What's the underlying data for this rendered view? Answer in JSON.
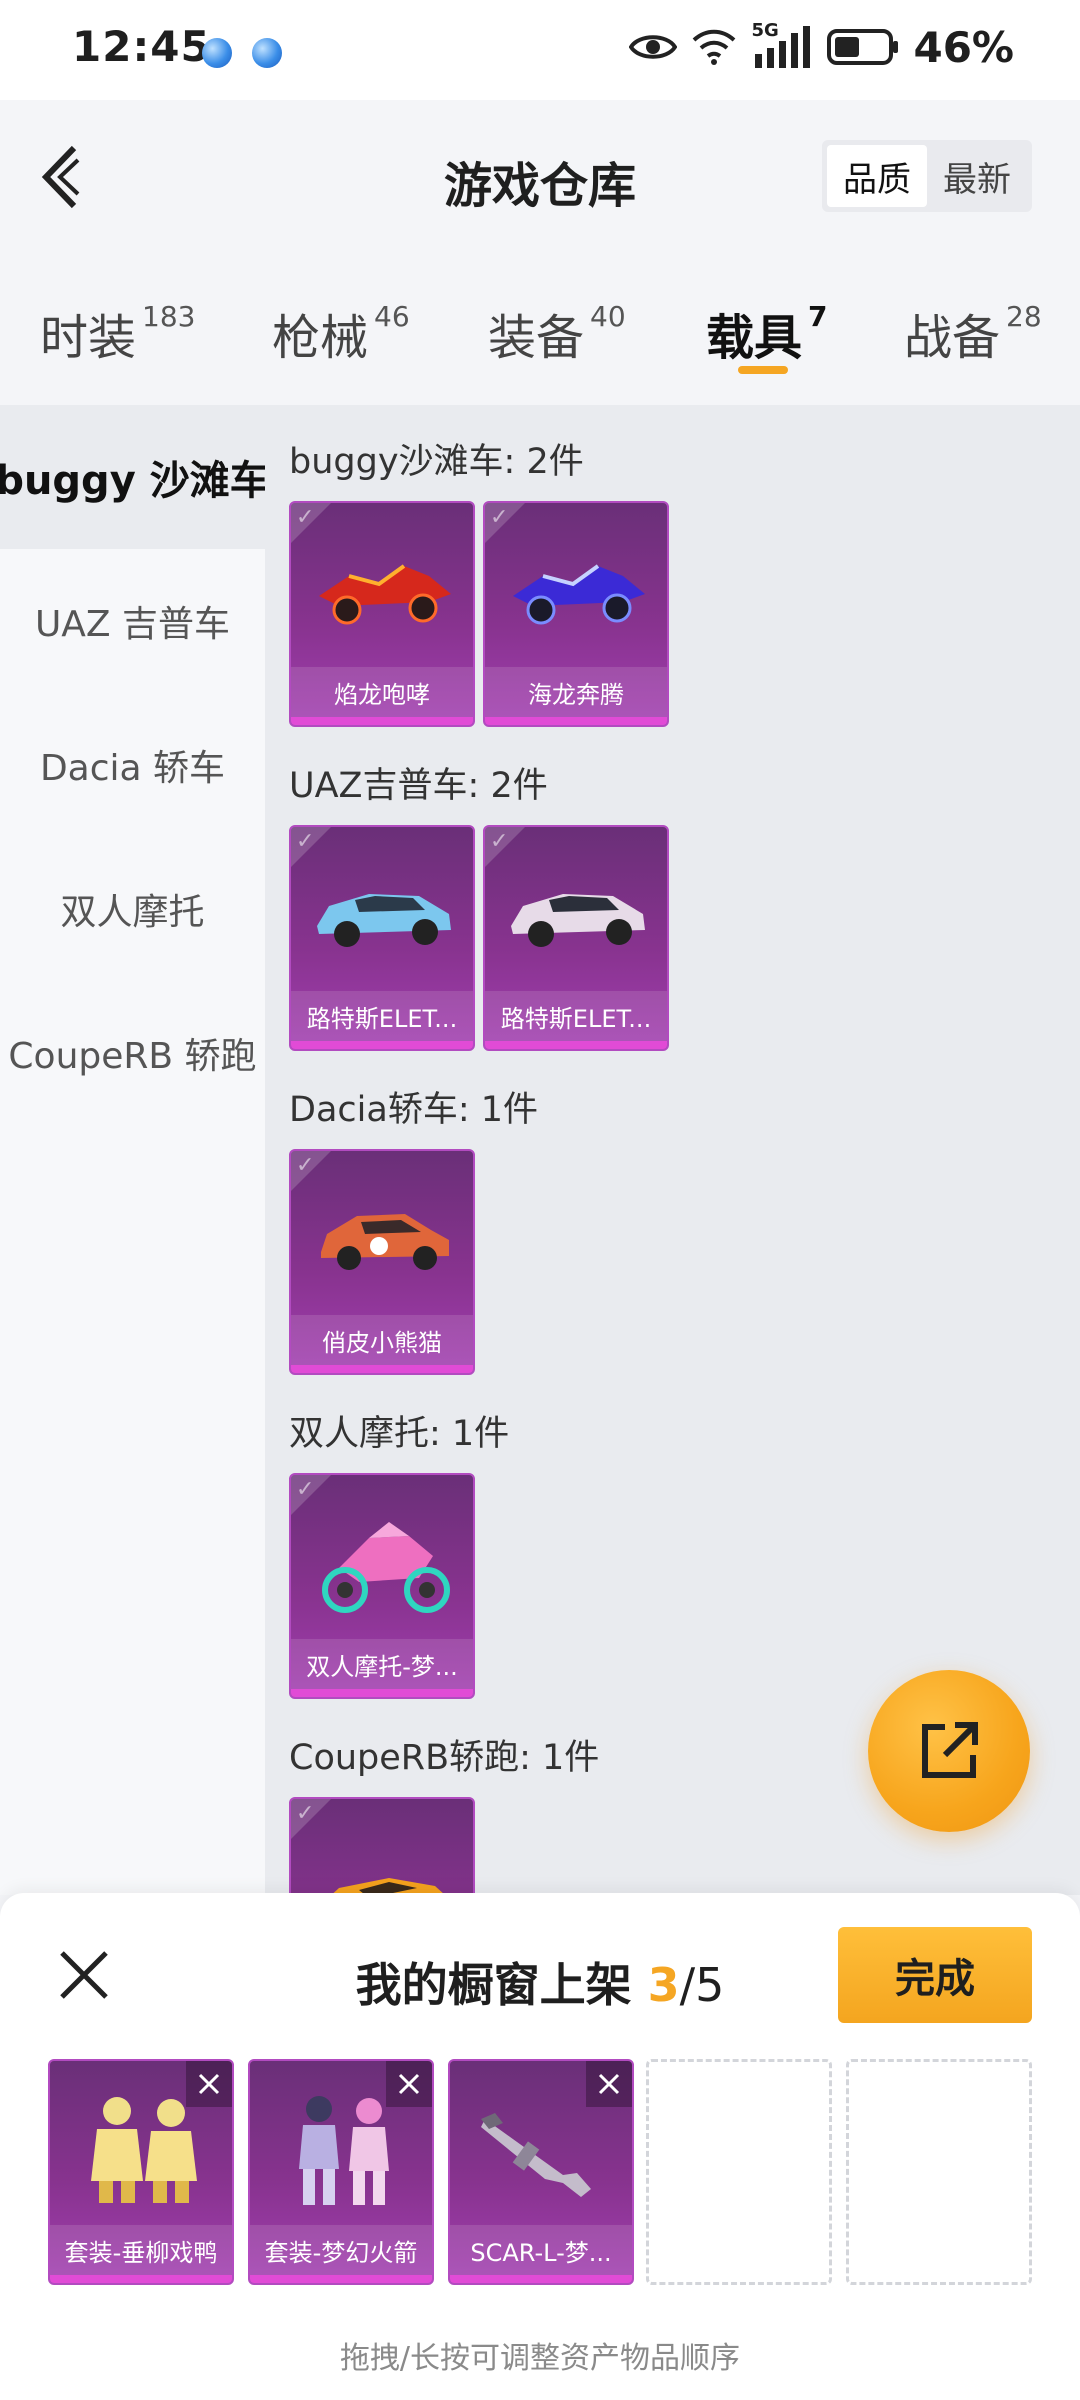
{
  "status_bar": {
    "time": "12:45",
    "network": "5G",
    "battery": "46%"
  },
  "header": {
    "title": "游戏仓库",
    "sort_options": [
      "品质",
      "最新"
    ],
    "sort_active": "品质"
  },
  "tabs": [
    {
      "label": "时装",
      "count": "183"
    },
    {
      "label": "枪械",
      "count": "46"
    },
    {
      "label": "装备",
      "count": "40"
    },
    {
      "label": "载具",
      "count": "7",
      "active": true
    },
    {
      "label": "战备",
      "count": "28"
    }
  ],
  "sidebar": {
    "items": [
      "buggy 沙滩车",
      "UAZ 吉普车",
      "Dacia 轿车",
      "双人摩托",
      "CoupeRB 轿跑"
    ],
    "active_index": 0
  },
  "groups": [
    {
      "title": "buggy沙滩车: 2件",
      "items": [
        {
          "name": "焰龙咆哮",
          "icon": "buggy-red-icon"
        },
        {
          "name": "海龙奔腾",
          "icon": "buggy-blue-icon"
        }
      ]
    },
    {
      "title": "UAZ吉普车: 2件",
      "items": [
        {
          "name": "路特斯ELET...",
          "icon": "suv-blue-icon"
        },
        {
          "name": "路特斯ELET...",
          "icon": "suv-white-icon"
        }
      ]
    },
    {
      "title": "Dacia轿车: 1件",
      "items": [
        {
          "name": "俏皮小熊猫",
          "icon": "car-orange-icon"
        }
      ]
    },
    {
      "title": "双人摩托: 1件",
      "items": [
        {
          "name": "双人摩托-梦...",
          "icon": "motorbike-pink-icon"
        }
      ]
    },
    {
      "title": "CoupeRB轿跑: 1件",
      "items": [
        {
          "name": "",
          "icon": "coupe-orange-icon"
        }
      ]
    }
  ],
  "showcase": {
    "title": "我的橱窗上架",
    "current": "3",
    "separator": "/",
    "total": "5",
    "done_label": "完成",
    "hint": "拖拽/长按可调整资产物品顺序",
    "slots": [
      {
        "name": "套装-垂柳戏鸭",
        "icon": "outfit-yellow-icon"
      },
      {
        "name": "套装-梦幻火箭",
        "icon": "outfit-space-icon"
      },
      {
        "name": "SCAR-L-梦...",
        "icon": "rifle-icon"
      }
    ]
  },
  "colors": {
    "accent": "#f5a623",
    "card_purple": "#88338f",
    "card_bar": "#e14bd6"
  }
}
